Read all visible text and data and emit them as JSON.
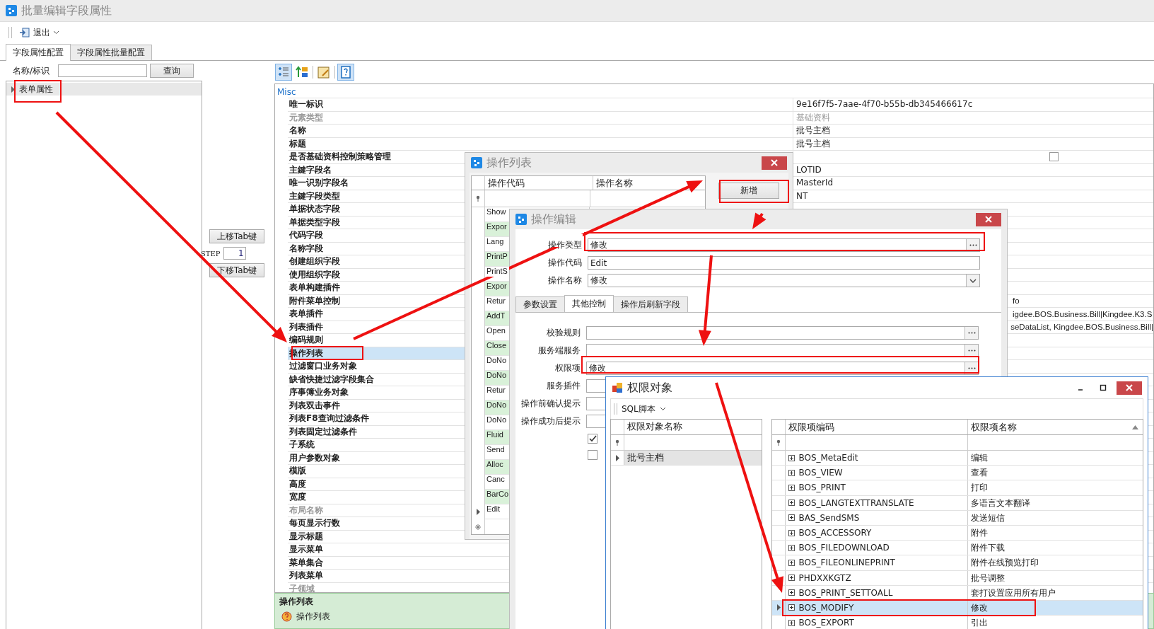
{
  "window": {
    "title": "批量编辑字段属性"
  },
  "toolbar": {
    "exit_label": "退出"
  },
  "tabs": [
    {
      "label": "字段属性配置",
      "selected": true
    },
    {
      "label": "字段属性批量配置",
      "selected": false
    }
  ],
  "search": {
    "label": "名称/标识",
    "button": "查询"
  },
  "tree": [
    {
      "label": "表单属性",
      "expanded": false
    }
  ],
  "tab_order": {
    "up_button": "上移Tab键",
    "step_label": "STEP",
    "step_value": "1",
    "down_button": "下移Tab键"
  },
  "property_grid": {
    "category": "Misc",
    "rows": [
      {
        "name": "唯一标识",
        "value": "9e16f7f5-7aae-4f70-b55b-db345466617c",
        "readonly": false,
        "selected": false
      },
      {
        "name": "元素类型",
        "value": "基础资料",
        "readonly": true,
        "selected": false
      },
      {
        "name": "名称",
        "value": "批号主档",
        "readonly": false,
        "selected": false
      },
      {
        "name": "标题",
        "value": "批号主档",
        "readonly": false,
        "selected": false
      },
      {
        "name": "是否基础资料控制策略管理",
        "kind": "checkbox",
        "checked": false,
        "readonly": false,
        "selected": false
      },
      {
        "name": "主鍵字段名",
        "value": "LOTID",
        "readonly": false,
        "selected": false
      },
      {
        "name": "唯一识别字段名",
        "value": "MasterId",
        "readonly": false,
        "selected": false
      },
      {
        "name": "主鍵字段类型",
        "value": "NT",
        "readonly": false,
        "selected": false
      },
      {
        "name": "单据状态字段",
        "readonly": false,
        "selected": false
      },
      {
        "name": "单据类型字段",
        "readonly": false,
        "selected": false
      },
      {
        "name": "代码字段",
        "readonly": false,
        "selected": false
      },
      {
        "name": "名称字段",
        "readonly": false,
        "selected": false
      },
      {
        "name": "创建组织字段",
        "readonly": false,
        "selected": false
      },
      {
        "name": "使用组织字段",
        "readonly": false,
        "selected": false
      },
      {
        "name": "表单构建插件",
        "readonly": false,
        "selected": false
      },
      {
        "name": "附件菜单控制",
        "value": "fo",
        "covered_left": true,
        "readonly": false,
        "selected": false
      },
      {
        "name": "表单插件",
        "value": "igdee.BOS.Business.Bill|Kingdee.K3.S",
        "covered_left": true,
        "readonly": false,
        "selected": false
      },
      {
        "name": "列表插件",
        "value": "seDataList, Kingdee.BOS.Business.Bill|",
        "covered_left": true,
        "readonly": false,
        "selected": false
      },
      {
        "name": "编码规则",
        "readonly": false,
        "selected": false
      },
      {
        "name": "操作列表",
        "readonly": false,
        "selected": true
      },
      {
        "name": "过滤窗口业务对象",
        "readonly": false,
        "selected": false
      },
      {
        "name": "缺省快捷过滤字段集合",
        "readonly": false,
        "selected": false
      },
      {
        "name": "序事簿业务对象",
        "readonly": false,
        "selected": false
      },
      {
        "name": "列表双击事件",
        "readonly": false,
        "selected": false
      },
      {
        "name": "列表F8查询过滤条件",
        "readonly": false,
        "selected": false
      },
      {
        "name": "列表固定过滤条件",
        "readonly": false,
        "selected": false
      },
      {
        "name": "子系统",
        "readonly": false,
        "selected": false
      },
      {
        "name": "用户参数对象",
        "readonly": false,
        "selected": false
      },
      {
        "name": "模版",
        "readonly": false,
        "selected": false
      },
      {
        "name": "高度",
        "readonly": false,
        "selected": false
      },
      {
        "name": "宽度",
        "readonly": false,
        "selected": false
      },
      {
        "name": "布局名称",
        "readonly": true,
        "selected": false
      },
      {
        "name": "每页显示行数",
        "readonly": false,
        "selected": false
      },
      {
        "name": "显示标题",
        "readonly": false,
        "selected": false
      },
      {
        "name": "显示菜单",
        "readonly": false,
        "selected": false
      },
      {
        "name": "菜单集合",
        "readonly": false,
        "selected": false
      },
      {
        "name": "列表菜单",
        "readonly": false,
        "selected": false
      },
      {
        "name": "子领域",
        "readonly": true,
        "selected": false
      }
    ]
  },
  "description": {
    "title": "操作列表",
    "text": "操作列表"
  },
  "operation_list_dialog": {
    "title": "操作列表",
    "columns": [
      "操作代码",
      "操作名称"
    ],
    "rows": [
      {
        "code": "Show",
        "selected": false
      },
      {
        "code": "Expor",
        "selected": false
      },
      {
        "code": "Lang",
        "selected": false
      },
      {
        "code": "PrintP",
        "selected": false
      },
      {
        "code": "PrintS",
        "selected": false
      },
      {
        "code": "Expor",
        "selected": false
      },
      {
        "code": "Retur",
        "selected": false
      },
      {
        "code": "AddT",
        "selected": false
      },
      {
        "code": "Open",
        "selected": false
      },
      {
        "code": "Close",
        "selected": false
      },
      {
        "code": "DoNo",
        "selected": false
      },
      {
        "code": "DoNo",
        "selected": false
      },
      {
        "code": "Retur",
        "selected": false
      },
      {
        "code": "DoNo",
        "selected": false
      },
      {
        "code": "DoNo",
        "selected": false
      },
      {
        "code": "Fluid",
        "selected": false
      },
      {
        "code": "Send",
        "selected": false
      },
      {
        "code": "Alloc",
        "selected": false
      },
      {
        "code": "Canc",
        "selected": false
      },
      {
        "code": "BarCo",
        "selected": false
      },
      {
        "code": "Edit",
        "selected": true
      }
    ],
    "add_button": "新增"
  },
  "operation_edit_dialog": {
    "title": "操作编辑",
    "fields": [
      {
        "label": "操作类型",
        "value": "修改",
        "kind": "lookup"
      },
      {
        "label": "操作代码",
        "value": "Edit",
        "kind": "text"
      },
      {
        "label": "操作名称",
        "value": "修改",
        "kind": "dropdown"
      }
    ],
    "tabs": [
      {
        "label": "参数设置",
        "selected": false
      },
      {
        "label": "其他控制",
        "selected": true
      },
      {
        "label": "操作后刷新字段",
        "selected": false
      }
    ],
    "tab_fields": [
      {
        "label": "校验规则",
        "kind": "lookup"
      },
      {
        "label": "服务端服务",
        "kind": "lookup"
      },
      {
        "label": "权限项",
        "value": "修改",
        "kind": "lookup"
      },
      {
        "label": "服务插件",
        "kind": "text"
      },
      {
        "label": "操作前确认提示",
        "kind": "text"
      },
      {
        "label": "操作成功后提示",
        "kind": "text"
      }
    ],
    "checkboxes": [
      {
        "checked": true
      },
      {
        "checked": false
      }
    ]
  },
  "permission_dialog": {
    "title": "权限对象",
    "toolbar_label": "SQL脚本",
    "objects": {
      "column": "权限对象名称",
      "rows": [
        {
          "name": "批号主档",
          "selected": true
        }
      ]
    },
    "items": {
      "columns": [
        "权限项编码",
        "权限项名称"
      ],
      "rows": [
        {
          "code": "BOS_MetaEdit",
          "name": "编辑",
          "selected": false
        },
        {
          "code": "BOS_VIEW",
          "name": "查看",
          "selected": false
        },
        {
          "code": "BOS_PRINT",
          "name": "打印",
          "selected": false
        },
        {
          "code": "BOS_LANGTEXTTRANSLATE",
          "name": "多语言文本翻译",
          "selected": false
        },
        {
          "code": "BAS_SendSMS",
          "name": "发送短信",
          "selected": false
        },
        {
          "code": "BOS_ACCESSORY",
          "name": "附件",
          "selected": false
        },
        {
          "code": "BOS_FILEDOWNLOAD",
          "name": "附件下载",
          "selected": false
        },
        {
          "code": "BOS_FILEONLINEPRINT",
          "name": "附件在线预览打印",
          "selected": false
        },
        {
          "code": "PHDXXKGTZ",
          "name": "批号调整",
          "selected": false
        },
        {
          "code": "BOS_PRINT_SETTOALL",
          "name": "套打设置应用所有用户",
          "selected": false
        },
        {
          "code": "BOS_MODIFY",
          "name": "修改",
          "selected": true
        },
        {
          "code": "BOS_EXPORT",
          "name": "引出",
          "selected": false
        }
      ]
    }
  }
}
